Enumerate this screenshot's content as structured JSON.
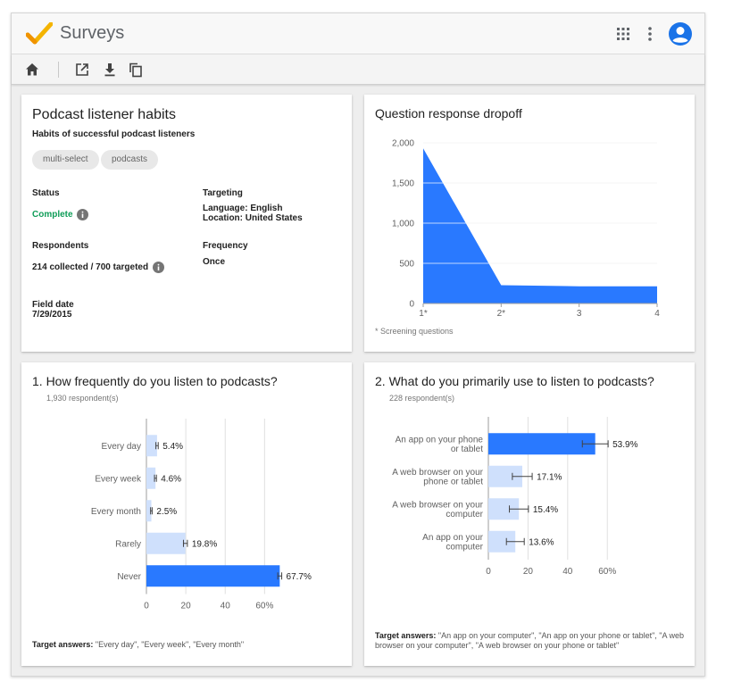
{
  "app": {
    "title": "Surveys",
    "accent": "#4285f4",
    "logo_colors": [
      "#f4b400",
      "#f09300"
    ]
  },
  "toolbar": {
    "icons": [
      "home-icon",
      "open-external-icon",
      "download-icon",
      "copy-icon"
    ]
  },
  "appbar_icons": [
    "apps-grid-icon",
    "more-vert-icon",
    "account-icon"
  ],
  "summary": {
    "title": "Podcast listener habits",
    "subtitle": "Habits of successful podcast listeners",
    "tags": [
      "multi-select",
      "podcasts"
    ],
    "status_label": "Status",
    "status_value": "Complete",
    "targeting_label": "Targeting",
    "targeting_language": "Language: English",
    "targeting_location": "Location: United States",
    "respondents_label": "Respondents",
    "respondents_value": "214 collected / 700 targeted",
    "frequency_label": "Frequency",
    "frequency_value": "Once",
    "field_date_label": "Field date",
    "field_date_value": "7/29/2015"
  },
  "dropoff": {
    "title": "Question response dropoff",
    "footnote": "* Screening questions"
  },
  "q1": {
    "title": "1.  How frequently do you listen to podcasts?",
    "respondents": "1,930 respondent(s)",
    "target_label": "Target answers:",
    "target_values": "\"Every day\", \"Every week\", \"Every month\""
  },
  "q2": {
    "title": "2.  What do you primarily use to listen to podcasts?",
    "respondents": "228 respondent(s)",
    "target_label": "Target answers:",
    "target_values": "\"An app on your computer\", \"An app on your phone or tablet\", \"A web browser on your computer\", \"A web browser on your phone or tablet\""
  },
  "chart_data": [
    {
      "type": "area",
      "title": "Question response dropoff",
      "x_tick_labels": [
        "1*",
        "2*",
        "3",
        "4"
      ],
      "values": [
        1930,
        228,
        214,
        214
      ],
      "y_ticks": [
        0,
        500,
        1000,
        1500,
        2000
      ],
      "y_tick_labels": [
        "0",
        "500",
        "1,000",
        "1,500",
        "2,000"
      ],
      "ylim": [
        0,
        2000
      ],
      "grid": true,
      "color": "#2979ff"
    },
    {
      "type": "bar",
      "orientation": "horizontal",
      "categories": [
        "Every day",
        "Every week",
        "Every month",
        "Rarely",
        "Never"
      ],
      "values": [
        5.4,
        4.6,
        2.5,
        19.8,
        67.7
      ],
      "value_labels": [
        "5.4%",
        "4.6%",
        "2.5%",
        "19.8%",
        "67.7%"
      ],
      "error": [
        0.6,
        0.5,
        0.4,
        1.0,
        1.0
      ],
      "target": [
        true,
        true,
        true,
        false,
        false
      ],
      "x_ticks": [
        0,
        20,
        40,
        60
      ],
      "x_tick_labels": [
        "0",
        "20",
        "40",
        "60%"
      ],
      "xlim": [
        0,
        68
      ],
      "grid": true,
      "colors": {
        "max": "#2979ff",
        "other": "#cfe0fc"
      }
    },
    {
      "type": "bar",
      "orientation": "horizontal",
      "categories": [
        [
          "An app on your phone",
          "or tablet"
        ],
        [
          "A web browser on your",
          "phone or tablet"
        ],
        [
          "A web browser on your",
          "computer"
        ],
        [
          "An app on your",
          "computer"
        ]
      ],
      "values": [
        53.9,
        17.1,
        15.4,
        13.6
      ],
      "value_labels": [
        "53.9%",
        "17.1%",
        "15.4%",
        "13.6%"
      ],
      "error": [
        6.5,
        5.0,
        4.8,
        4.5
      ],
      "x_ticks": [
        0,
        20,
        40,
        60
      ],
      "x_tick_labels": [
        "0",
        "20",
        "40",
        "60%"
      ],
      "xlim": [
        0,
        68
      ],
      "grid": true,
      "colors": {
        "max": "#2979ff",
        "other": "#cfe0fc"
      }
    }
  ]
}
